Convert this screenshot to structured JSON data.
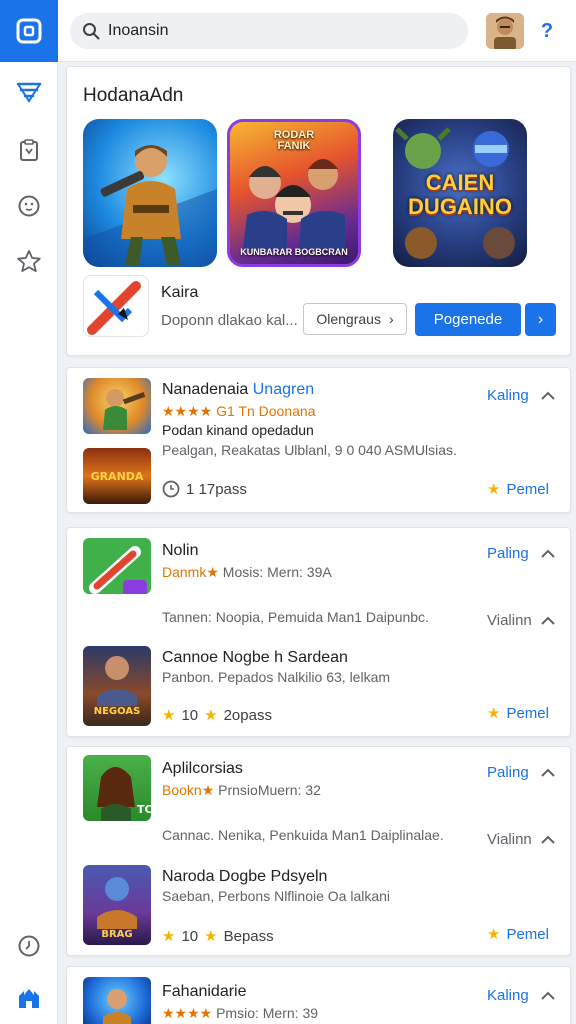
{
  "search": {
    "value": "Inoansin"
  },
  "featured": {
    "title": "HodanaAdn",
    "banners": [
      {
        "name": "banner-hero-soldier"
      },
      {
        "caption_top": "RODAR\nFANIK",
        "caption_bottom": "KUNBARAR BOGBCRAN"
      },
      {
        "caption": "CAIEN\nDUGAINO"
      }
    ],
    "app_name": "Kaira",
    "app_desc": "Doponn dlakao kal...",
    "outline_button": "Olengraus",
    "primary_button": "Pogenede"
  },
  "cards": [
    {
      "title_a": "Nanadenaia",
      "title_b": "Unagren",
      "rating_text": "★★★★ G1",
      "rating_suffix": "Tn Doonana",
      "line1": "Podan kinand opedadun",
      "line2": "Pealgan, Reakatas Ulblanl, 9 0  040 ASMUlsias.",
      "foot_left": "1 17pass",
      "link": "Kaling",
      "right_action": "Pemel"
    },
    {
      "title": "Nolin",
      "rating_text": "Danmk★",
      "sub": "Mosis: Mern: 39A",
      "link": "Paling",
      "mid_line": "Tannen: Noopia, Pemuida Man1 Daipunbc.",
      "mid_link": "Vialinn",
      "title2": "Cannoe Nogbe h Sardean",
      "sub2": "Panbon. Pepados Nalkilio 63, lelkam",
      "foot_left": "10",
      "foot_pass": "2opass",
      "right_action": "Pemel"
    },
    {
      "title": "Aplilcorsias",
      "rating_text": "Bookn★",
      "sub": "PrnsioMuern: 32",
      "link": "Paling",
      "mid_line": "Cannac. Nenika, Penkuida Man1 Daiplinalae.",
      "mid_link": "Vialinn",
      "title2": "Naroda Dogbe Pdsyeln",
      "sub2": "Saeban, Perbons Nlflinoie Oa lalkani",
      "foot_left": "10",
      "foot_pass": "Bepass",
      "right_action": "Pemel"
    },
    {
      "title": "Fahanidarie",
      "rating_text": "★★★★",
      "sub": "Pmsio: Mern: 39",
      "link": "Kaling"
    }
  ]
}
